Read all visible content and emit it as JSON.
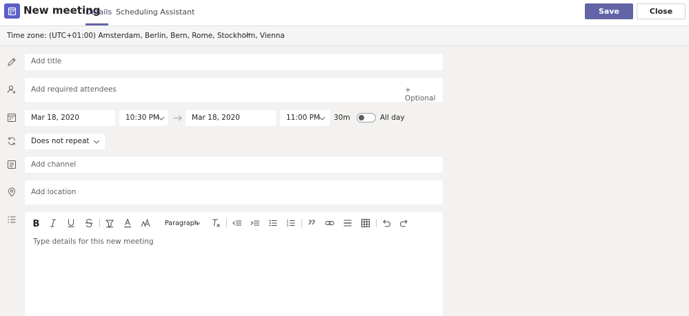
{
  "header": {
    "title": "New meeting",
    "tabs": [
      {
        "label": "Details",
        "active": true
      },
      {
        "label": "Scheduling Assistant",
        "active": false
      }
    ],
    "save_label": "Save",
    "close_label": "Close",
    "accent_color": "#6264a7"
  },
  "timezone": {
    "label": "Time zone: (UTC+01:00) Amsterdam, Berlin, Bern, Rome, Stockholm, Vienna"
  },
  "form": {
    "title_placeholder": "Add title",
    "attendees_placeholder": "Add required attendees",
    "optional_label": "+ Optional",
    "start_date": "Mar 18, 2020",
    "start_time": "10:30 PM",
    "end_date": "Mar 18, 2020",
    "end_time": "11:00 PM",
    "duration": "30m",
    "all_day_label": "All day",
    "all_day_on": false,
    "repeat_value": "Does not repeat",
    "channel_placeholder": "Add channel",
    "location_placeholder": "Add location",
    "paragraph_label": "Paragraph",
    "details_placeholder": "Type details for this new meeting"
  }
}
